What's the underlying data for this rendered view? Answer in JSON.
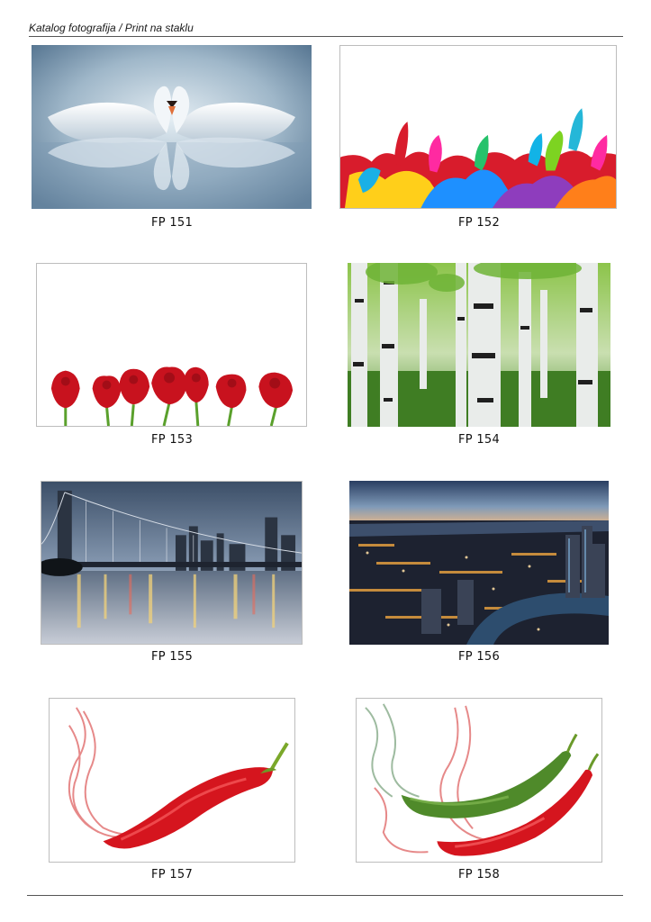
{
  "header": {
    "title": "Katalog fotografija / Print na staklu"
  },
  "items": [
    {
      "code": "FP 151",
      "subject": "two-swans-heart"
    },
    {
      "code": "FP 152",
      "subject": "paint-splash"
    },
    {
      "code": "FP 153",
      "subject": "red-roses-row"
    },
    {
      "code": "FP 154",
      "subject": "birch-forest"
    },
    {
      "code": "FP 155",
      "subject": "brooklyn-bridge-night"
    },
    {
      "code": "FP 156",
      "subject": "city-aerial-night"
    },
    {
      "code": "FP 157",
      "subject": "red-chili-smoke"
    },
    {
      "code": "FP 158",
      "subject": "green-red-chili-smoke"
    }
  ]
}
